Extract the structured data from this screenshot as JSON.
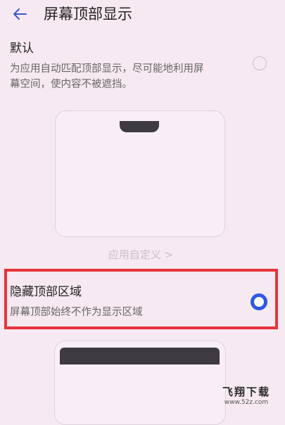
{
  "header": {
    "title": "屏幕顶部显示"
  },
  "options": [
    {
      "title": "默认",
      "desc_line1": "为应用自动匹配顶部显示，尽可能地利用屏",
      "desc_line2": "幕空间，使内容不被遮挡。",
      "selected": false
    },
    {
      "title": "隐藏顶部区域",
      "desc": "屏幕顶部始终不作为显示区域",
      "selected": true
    }
  ],
  "app_custom_link": "应用自定义 >",
  "watermark": {
    "logo": "飞翔下载",
    "url": "www.52z.com"
  },
  "colors": {
    "accent": "#2e58e6",
    "highlight": "#e6343a",
    "background": "#f6e9f1"
  }
}
